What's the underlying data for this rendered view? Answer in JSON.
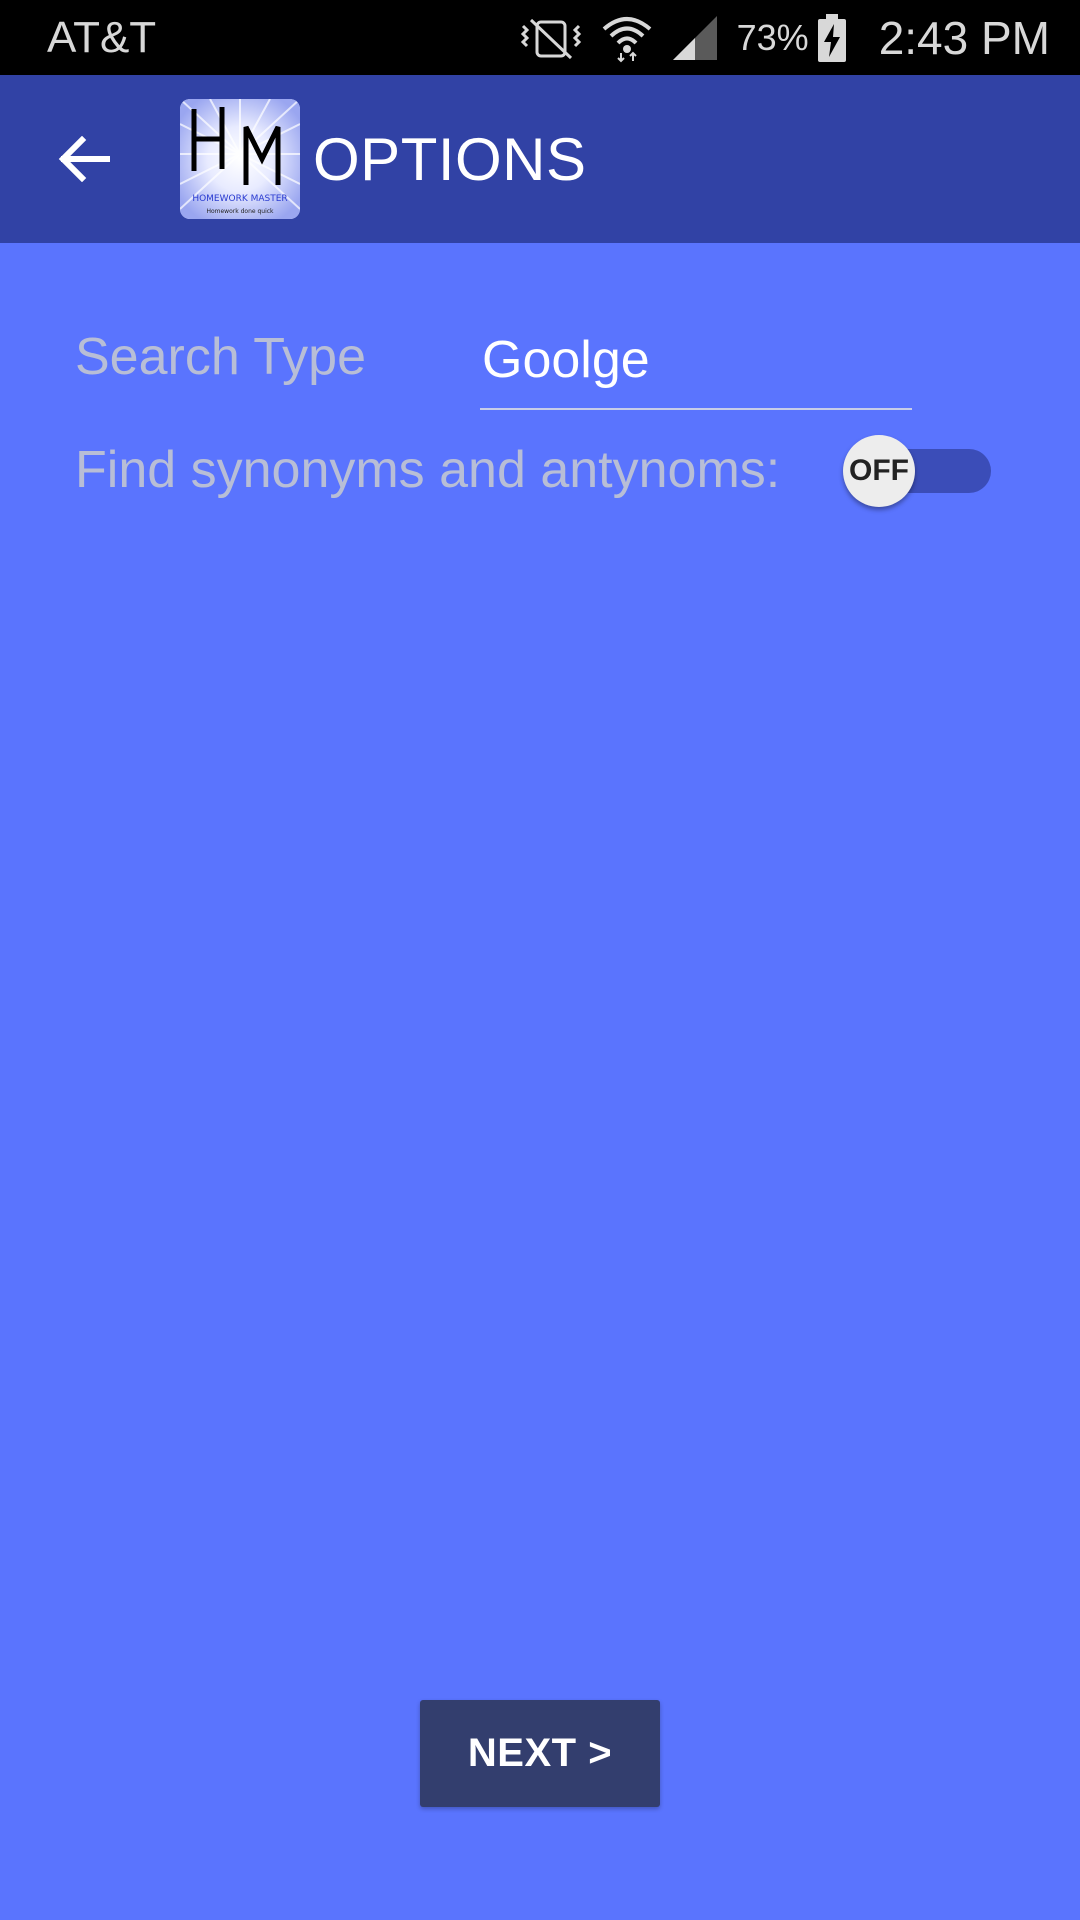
{
  "status_bar": {
    "carrier": "AT&T",
    "battery_percent": "73%",
    "time": "2:43 PM",
    "icons": [
      "vibrate-mute-icon",
      "wifi-icon",
      "cell-signal-icon",
      "battery-charging-icon"
    ]
  },
  "app_bar": {
    "title": "OPTIONS",
    "back_icon": "arrow-back-icon",
    "logo": {
      "letters": "HM",
      "name": "HOMEWORK MASTER",
      "tagline": "Homework done quick"
    }
  },
  "settings": {
    "search_type_label": "Search Type",
    "search_type_value": "Goolge",
    "synonyms_label": "Find synonyms and antynoms:",
    "synonyms_toggle": {
      "state": "OFF",
      "on": false
    }
  },
  "next_button_label": "NEXT >",
  "colors": {
    "background": "#5a74fe",
    "app_bar": "#3142a5",
    "button": "#333e6e",
    "label": "#b8bed6",
    "toggle_track": "#3b4db8"
  }
}
